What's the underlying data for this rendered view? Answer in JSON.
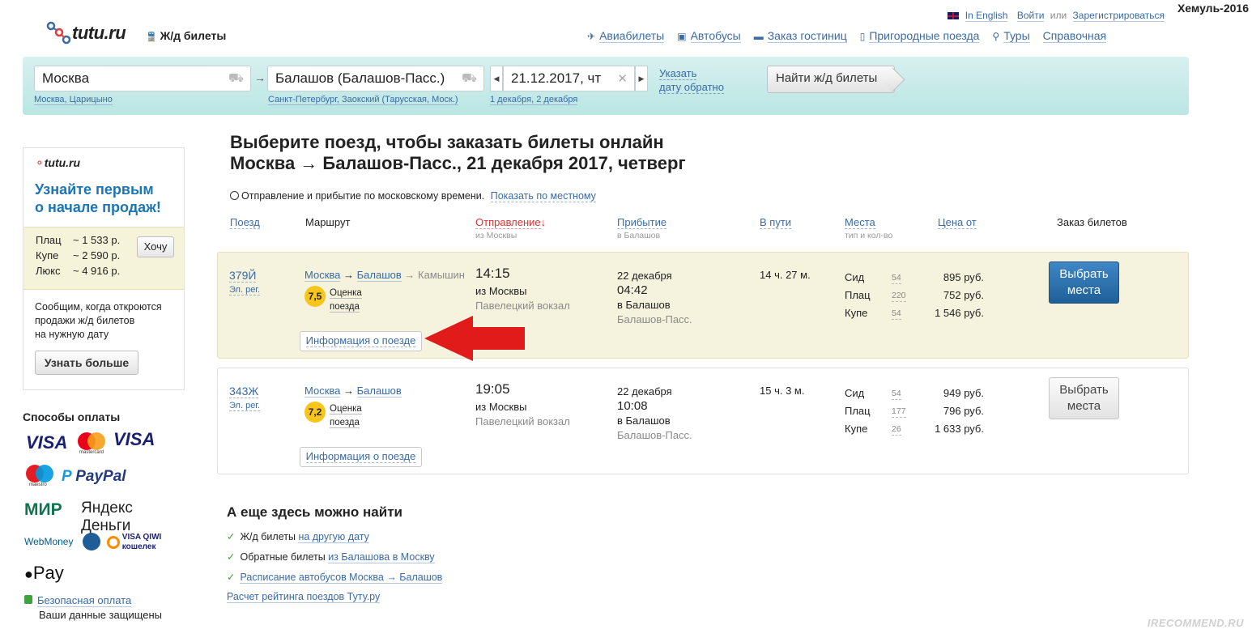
{
  "watermark": "Хемуль-2016",
  "top_links": {
    "english": "In English",
    "login": "Войти",
    "or": "или",
    "register": "Зарегистрироваться"
  },
  "logo": "tutu.ru",
  "section": "Ж/д билеты",
  "nav": [
    {
      "label": "Авиабилеты",
      "icon": "plane-icon"
    },
    {
      "label": "Автобусы",
      "icon": "bus-icon"
    },
    {
      "label": "Заказ гостиниц",
      "icon": "bed-icon"
    },
    {
      "label": "Пригородные поезда",
      "icon": "train-icon"
    },
    {
      "label": "Туры",
      "icon": "pin-icon"
    },
    {
      "label": "Справочная",
      "icon": ""
    }
  ],
  "search": {
    "from": "Москва",
    "from_suggest": "Москва, Царицыно",
    "to": "Балашов (Балашов-Пасс.)",
    "to_suggest": "Санкт-Петербург, Заокский (Тарусская, Моск.)",
    "date": "21.12.2017, чт",
    "date_suggest": "1 декабря, 2 декабря",
    "return_line1": "Указать",
    "return_line2": "дату обратно",
    "find_button": "Найти ж/д билеты"
  },
  "promo": {
    "logo": "tutu.ru",
    "title_line1": "Узнайте первым",
    "title_line2": "о начале продаж!",
    "prices": [
      {
        "label": "Плац",
        "value": "~ 1 533 р."
      },
      {
        "label": "Купе",
        "value": "~ 2 590 р."
      },
      {
        "label": "Люкс",
        "value": "~ 4 916 р."
      }
    ],
    "want_button": "Хочу",
    "text_line1": "Сообщим, когда откроются",
    "text_line2": "продажи ж/д билетов",
    "text_line3": "на нужную дату",
    "learn_button": "Узнать больше"
  },
  "payments": {
    "title": "Способы оплаты",
    "logos": [
      "VISA",
      "mastercard",
      "VISA Electron",
      "maestro",
      "PayPal",
      "МИР",
      "Яндекс Деньги",
      "WebMoney",
      "VISA QIWI кошелек",
      "Pay"
    ],
    "secure_link": "Безопасная оплата",
    "secure_text": "Ваши данные защищены"
  },
  "main": {
    "headline_line1": "Выберите поезд, чтобы заказать билеты онлайн",
    "headline_line2": "Москва → Балашов-Пасс., 21 декабря 2017, четверг",
    "time_note": "Отправление и прибытие по московскому времени.",
    "time_link": "Показать по местному"
  },
  "columns": {
    "train": "Поезд",
    "route": "Маршрут",
    "departure": "Отправление",
    "departure_sub": "из Москвы",
    "arrival": "Прибытие",
    "arrival_sub": "в Балашов",
    "duration": "В пути",
    "seats": "Места",
    "seats_sub": "тип и кол-во",
    "price": "Цена от",
    "order": "Заказ билетов"
  },
  "trains": [
    {
      "number": "379Й",
      "type": "Эл. рег.",
      "route_from": "Москва",
      "route_to": "Балашов",
      "route_end": "→ Камышин",
      "score": "7,5",
      "score_l1": "Оценка",
      "score_l2": "поезда",
      "info": "Информация о поезде",
      "dep_time": "14:15",
      "dep_from": "из Москвы",
      "dep_station": "Павелецкий вокзал",
      "arr_date": "22 декабря",
      "arr_time": "04:42",
      "arr_to": "в Балашов",
      "arr_station": "Балашов-Пасс.",
      "duration": "14 ч. 27 м.",
      "seats": [
        {
          "type": "Сид",
          "count": "54",
          "price": "895 руб."
        },
        {
          "type": "Плац",
          "count": "220",
          "price": "752 руб."
        },
        {
          "type": "Купе",
          "count": "54",
          "price": "1 546 руб."
        }
      ],
      "choose_l1": "Выбрать",
      "choose_l2": "места"
    },
    {
      "number": "343Ж",
      "type": "Эл. рег.",
      "route_from": "Москва",
      "route_to": "Балашов",
      "route_end": "",
      "score": "7,2",
      "score_l1": "Оценка",
      "score_l2": "поезда",
      "info": "Информация о поезде",
      "dep_time": "19:05",
      "dep_from": "из Москвы",
      "dep_station": "Павелецкий вокзал",
      "arr_date": "22 декабря",
      "arr_time": "10:08",
      "arr_to": "в Балашов",
      "arr_station": "Балашов-Пасс.",
      "duration": "15 ч. 3 м.",
      "seats": [
        {
          "type": "Сид",
          "count": "54",
          "price": "949 руб."
        },
        {
          "type": "Плац",
          "count": "177",
          "price": "796 руб."
        },
        {
          "type": "Купе",
          "count": "26",
          "price": "1 633 руб."
        }
      ],
      "choose_l1": "Выбрать",
      "choose_l2": "места"
    }
  ],
  "more": {
    "title": "А еще здесь можно найти",
    "items": [
      {
        "prefix": "Ж/д билеты",
        "link": "на другую дату"
      },
      {
        "prefix": "Обратные билеты",
        "link": "из Балашова в Москву"
      },
      {
        "prefix": "",
        "link": "Расписание автобусов Москва → Балашов"
      }
    ],
    "rating_link": "Расчет рейтинга поездов Туту.ру"
  },
  "recommend_watermark": "IRECOMMEND.RU",
  "colors": {
    "accent": "#3a6ba5",
    "highlight_row": "#f5f3dd",
    "search_bg": "#c6eae8",
    "primary_button": "#2a6fad",
    "arrow": "#e11a1a"
  }
}
